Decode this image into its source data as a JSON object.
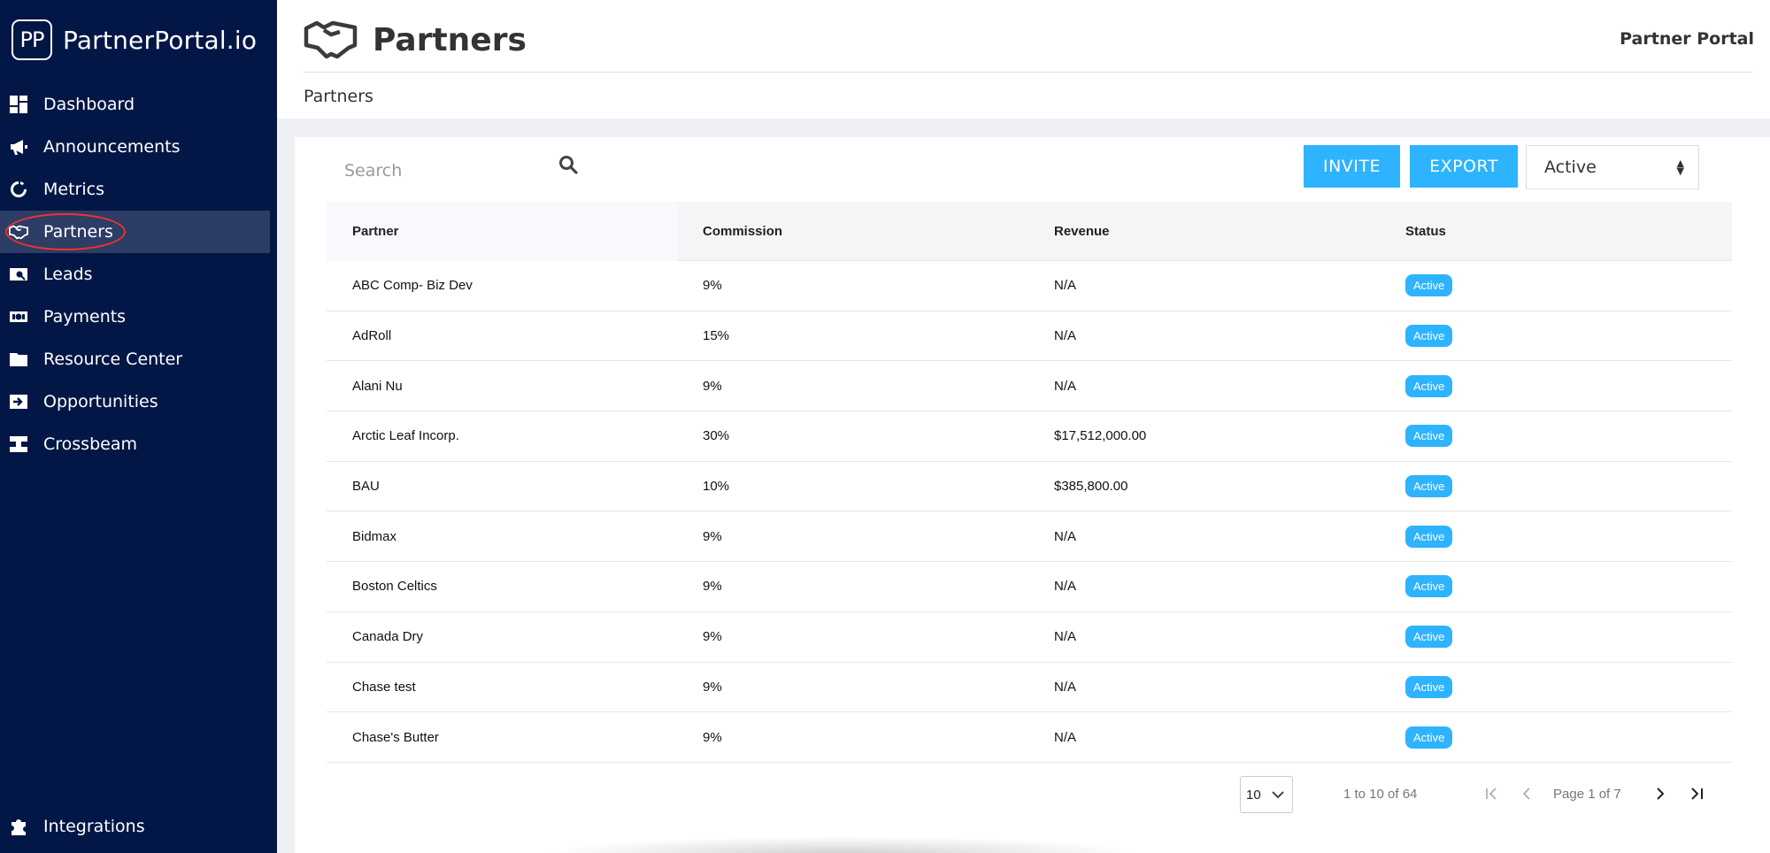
{
  "brand": {
    "logo_text": "PP",
    "name": "PartnerPortal.io"
  },
  "sidebar": {
    "items": [
      {
        "label": "Dashboard",
        "icon": "dashboard-icon"
      },
      {
        "label": "Announcements",
        "icon": "megaphone-icon"
      },
      {
        "label": "Metrics",
        "icon": "metrics-icon"
      },
      {
        "label": "Partners",
        "icon": "handshake-icon",
        "active": true
      },
      {
        "label": "Leads",
        "icon": "leads-icon"
      },
      {
        "label": "Payments",
        "icon": "money-icon"
      },
      {
        "label": "Resource Center",
        "icon": "folder-icon"
      },
      {
        "label": "Opportunities",
        "icon": "opportunity-icon"
      },
      {
        "label": "Crossbeam",
        "icon": "crossbeam-icon"
      }
    ],
    "bottom": {
      "label": "Integrations",
      "icon": "puzzle-icon"
    }
  },
  "header": {
    "title": "Partners",
    "app_name": "Partner Portal",
    "breadcrumb": "Partners"
  },
  "toolbar": {
    "search_placeholder": "Search",
    "invite_label": "INVITE",
    "export_label": "EXPORT",
    "status_filter": "Active"
  },
  "table": {
    "columns": [
      "Partner",
      "Commission",
      "Revenue",
      "Status"
    ],
    "rows": [
      {
        "partner": "ABC Comp- Biz Dev",
        "commission": "9%",
        "revenue": "N/A",
        "status": "Active"
      },
      {
        "partner": "AdRoll",
        "commission": "15%",
        "revenue": "N/A",
        "status": "Active"
      },
      {
        "partner": "Alani Nu",
        "commission": "9%",
        "revenue": "N/A",
        "status": "Active"
      },
      {
        "partner": "Arctic Leaf Incorp.",
        "commission": "30%",
        "revenue": "$17,512,000.00",
        "status": "Active"
      },
      {
        "partner": "BAU",
        "commission": "10%",
        "revenue": "$385,800.00",
        "status": "Active"
      },
      {
        "partner": "Bidmax",
        "commission": "9%",
        "revenue": "N/A",
        "status": "Active"
      },
      {
        "partner": "Boston Celtics",
        "commission": "9%",
        "revenue": "N/A",
        "status": "Active"
      },
      {
        "partner": "Canada Dry",
        "commission": "9%",
        "revenue": "N/A",
        "status": "Active"
      },
      {
        "partner": "Chase test",
        "commission": "9%",
        "revenue": "N/A",
        "status": "Active"
      },
      {
        "partner": "Chase's Butter",
        "commission": "9%",
        "revenue": "N/A",
        "status": "Active"
      }
    ]
  },
  "pagination": {
    "page_size": "10",
    "range_text": "1 to 10 of 64",
    "page_text": "Page 1 of 7"
  },
  "colors": {
    "sidebar_bg": "#031746",
    "accent": "#2eb3ff",
    "active_item_bg": "#2c3d66"
  }
}
